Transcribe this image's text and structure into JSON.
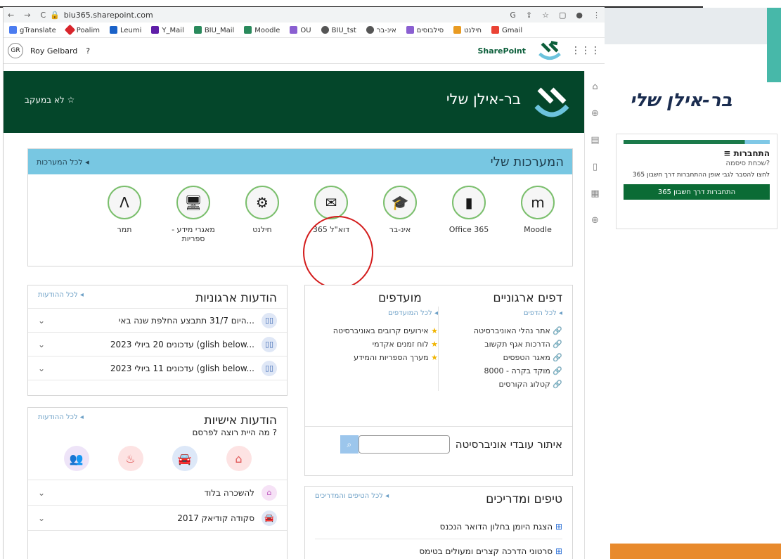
{
  "browser": {
    "url": "biu365.sharepoint.com"
  },
  "bookmarks": [
    "gTranslate",
    "Poalim",
    "Leumi",
    "Y_Mail",
    "BIU_Mail",
    "Moodle",
    "OU",
    "BIU_tst",
    "אינ-בר",
    "סילבוסים",
    "חילנט",
    "Gmail"
  ],
  "spbar": {
    "initials": "GR",
    "user": "Roy Gelbard",
    "help": "?",
    "brand": "SharePoint"
  },
  "hero": {
    "title": "בר-אילן שלי",
    "follow": "לא במעקב ☆"
  },
  "systems": {
    "title": "המערכות שלי",
    "all": "לכל המערכות ◂",
    "items": [
      {
        "label": "Moodle",
        "glyph": "m"
      },
      {
        "label": "Office 365",
        "glyph": "▮"
      },
      {
        "label": "אינ-בר",
        "glyph": "🎓"
      },
      {
        "label": "דוא\"ל 365",
        "glyph": "✉"
      },
      {
        "label": "חילנט",
        "glyph": "⚙"
      },
      {
        "label": "מאגרי מידע - ספריות",
        "glyph": "🖥"
      },
      {
        "label": "תמר",
        "glyph": "Λ"
      }
    ]
  },
  "org_pages": {
    "title": "דפים ארגוניים",
    "all": "לכל הדפים ◂",
    "links": [
      "אתר נהלי האוניברסיטה",
      "הדרכות אגף תקשוב",
      "מאגר הטפסים",
      "מוקד בקרה - 8000",
      "קטלוג הקורסים"
    ]
  },
  "favorites": {
    "title": "מועדפים",
    "all": "לכל המועדפים ◂",
    "links": [
      "אירועים קרובים באוניברסיטה",
      "לוח זמנים אקדמי",
      "מערך הספריות והמידע"
    ]
  },
  "search": {
    "label": "איתור עובדי אוניברסיטה"
  },
  "org_news": {
    "title": "הודעות ארגוניות",
    "all": "לכל ההודעות ◂",
    "items": [
      "היום 31/7 תתבצע החלפת שנה באי...",
      "עדכונים 20 ביולי 2023 (glish below...",
      "עדכונים 11 ביולי 2023 (glish below..."
    ]
  },
  "personal_news": {
    "title": "הודעות אישיות",
    "all": "לכל ההודעות ◂",
    "prompt": "מה היית רוצה לפרסם ?",
    "items": [
      "להשכרה בלוד",
      "סקודה קודיאק 2017"
    ]
  },
  "tips": {
    "title": "טיפים ומדריכים",
    "all": "לכל הטיפים והמדריכים ◂",
    "items": [
      "הצגת היומן בחלון הדואר הנכנס",
      "סרטוני הדרכה קצרים ומעולים בטימס"
    ]
  },
  "side": {
    "title": "בר-אילן שלי",
    "login_title": "≡ התחברות",
    "forgot": "שכחת סיסמה?",
    "explain": "לחצו להסבר לגבי אופן ההתחברות דרך חשבון 365",
    "button": "התחברות דרך חשבון 365"
  }
}
